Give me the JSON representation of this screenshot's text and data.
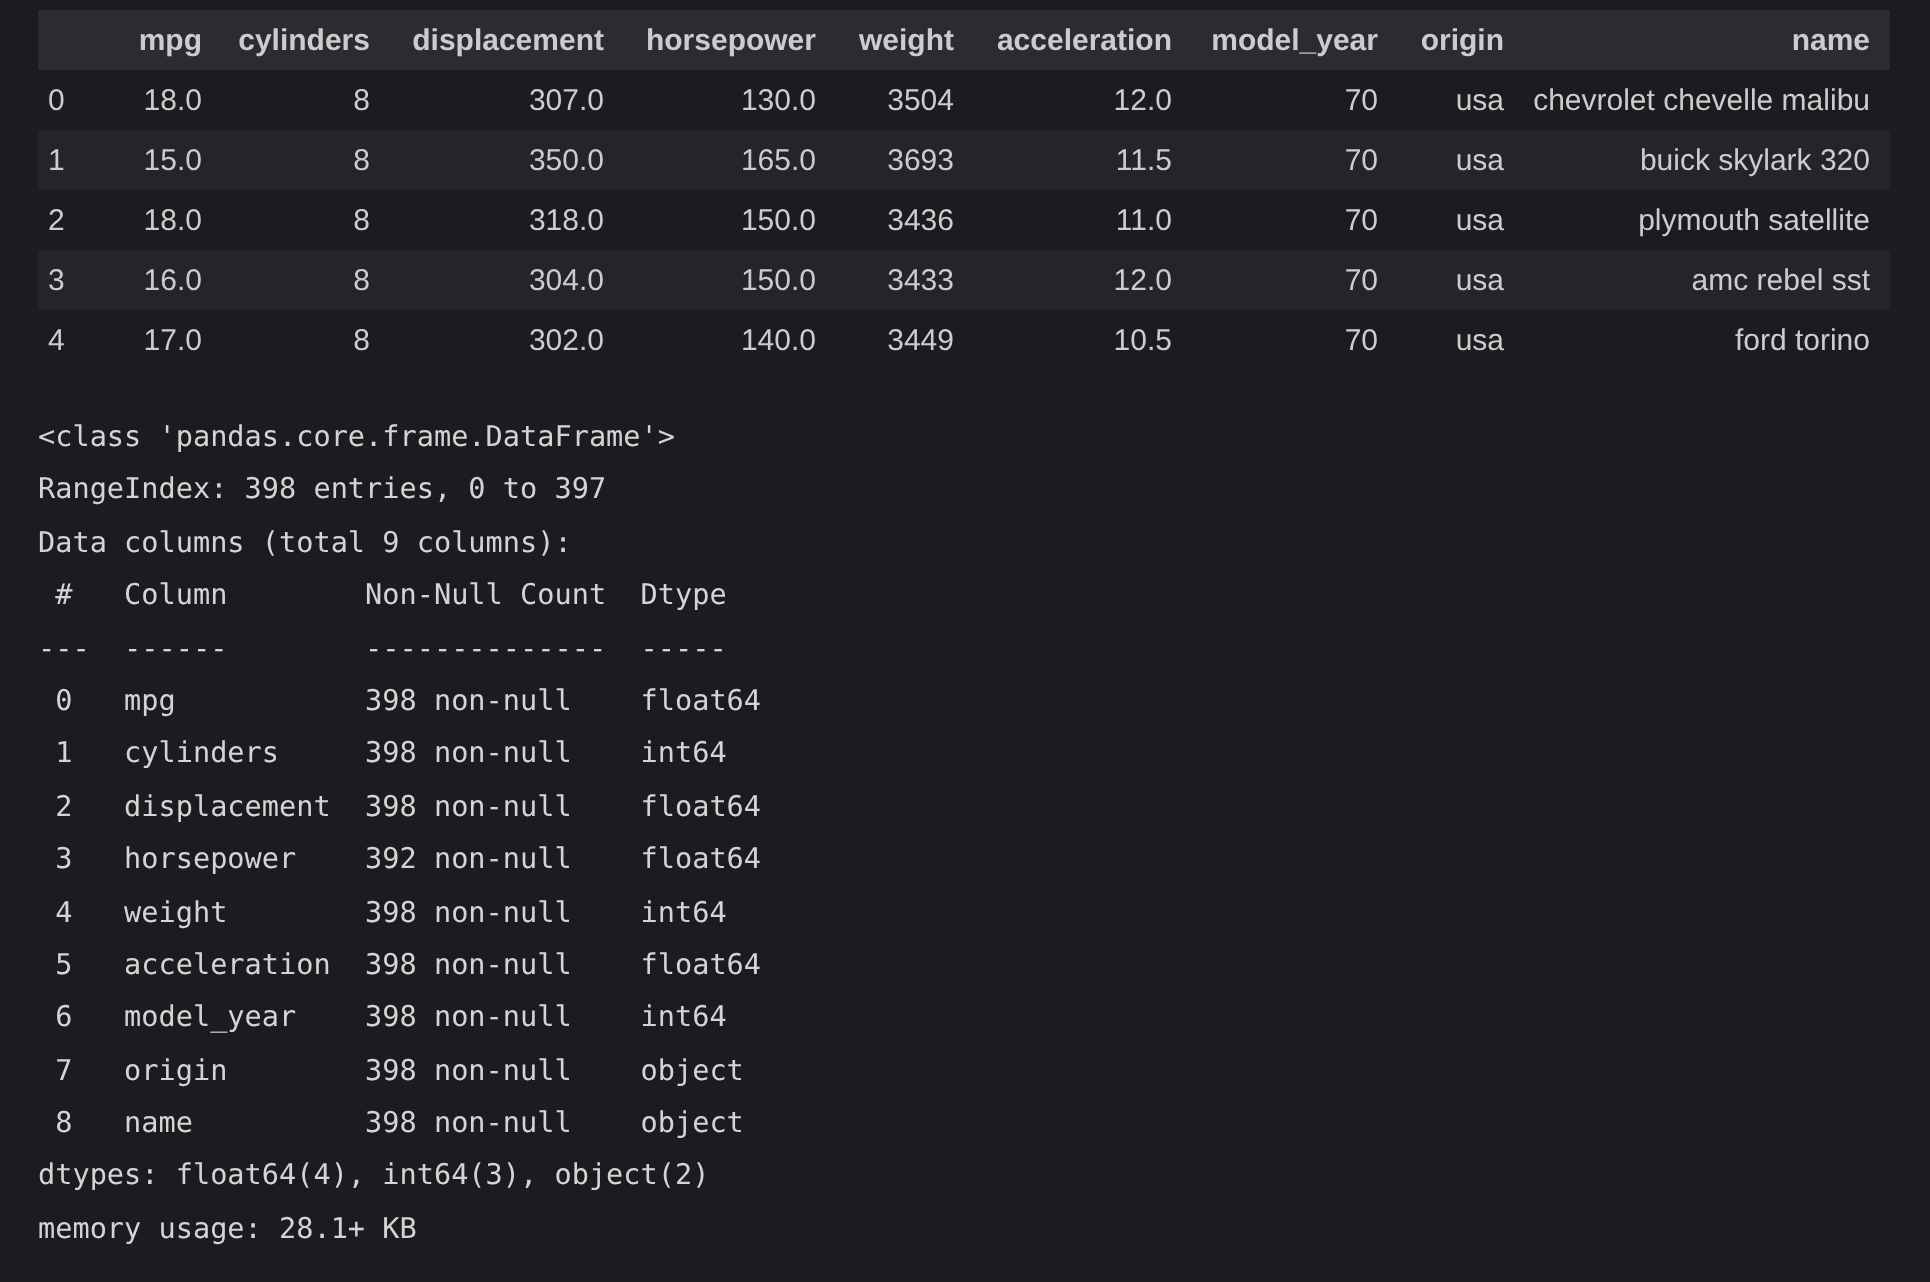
{
  "dataframe": {
    "columns": [
      "mpg",
      "cylinders",
      "displacement",
      "horsepower",
      "weight",
      "acceleration",
      "model_year",
      "origin",
      "name"
    ],
    "rows": [
      {
        "index": "0",
        "cells": [
          "18.0",
          "8",
          "307.0",
          "130.0",
          "3504",
          "12.0",
          "70",
          "usa",
          "chevrolet chevelle malibu"
        ]
      },
      {
        "index": "1",
        "cells": [
          "15.0",
          "8",
          "350.0",
          "165.0",
          "3693",
          "11.5",
          "70",
          "usa",
          "buick skylark 320"
        ]
      },
      {
        "index": "2",
        "cells": [
          "18.0",
          "8",
          "318.0",
          "150.0",
          "3436",
          "11.0",
          "70",
          "usa",
          "plymouth satellite"
        ]
      },
      {
        "index": "3",
        "cells": [
          "16.0",
          "8",
          "304.0",
          "150.0",
          "3433",
          "12.0",
          "70",
          "usa",
          "amc rebel sst"
        ]
      },
      {
        "index": "4",
        "cells": [
          "17.0",
          "8",
          "302.0",
          "140.0",
          "3449",
          "10.5",
          "70",
          "usa",
          "ford torino"
        ]
      }
    ]
  },
  "info_output": {
    "lines": [
      "<class 'pandas.core.frame.DataFrame'>",
      "RangeIndex: 398 entries, 0 to 397",
      "Data columns (total 9 columns):",
      " #   Column        Non-Null Count  Dtype",
      "---  ------        --------------  -----",
      " 0   mpg           398 non-null    float64",
      " 1   cylinders     398 non-null    int64",
      " 2   displacement  398 non-null    float64",
      " 3   horsepower    392 non-null    float64",
      " 4   weight        398 non-null    int64",
      " 5   acceleration  398 non-null    float64",
      " 6   model_year    398 non-null    int64",
      " 7   origin        398 non-null    object",
      " 8   name          398 non-null    object",
      "dtypes: float64(4), int64(3), object(2)",
      "memory usage: 28.1+ KB"
    ]
  }
}
